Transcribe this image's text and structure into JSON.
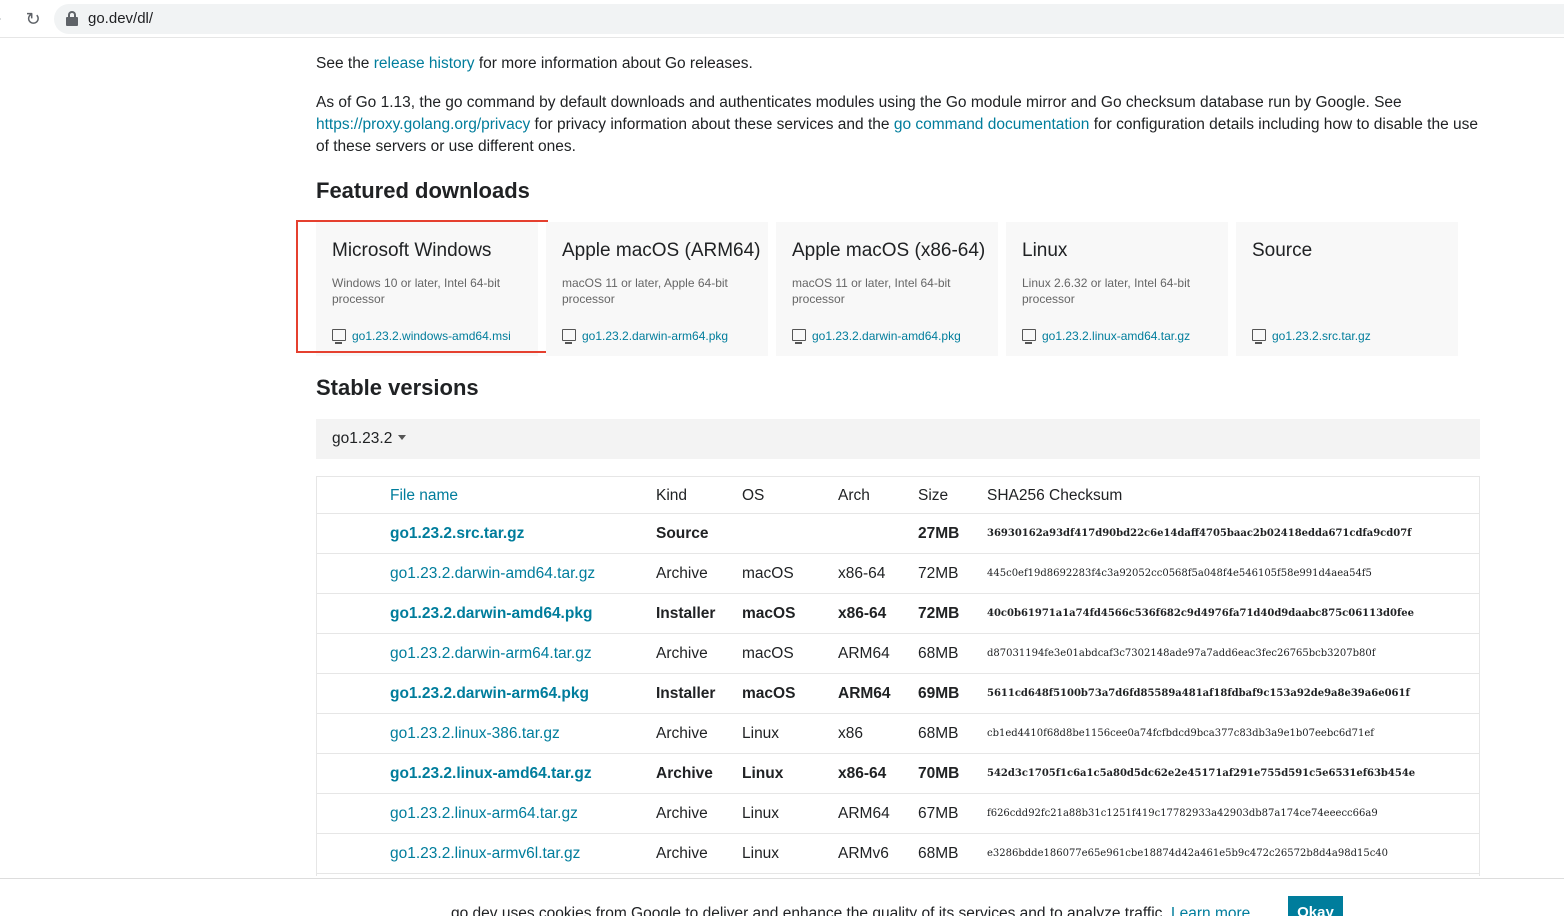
{
  "browser": {
    "url": "go.dev/dl/"
  },
  "intro": {
    "p1_before": "See the ",
    "p1_link": "release history",
    "p1_after": " for more information about Go releases.",
    "p2_part1": "As of Go 1.13, the go command by default downloads and authenticates modules using the Go module mirror and Go checksum database run by Google. See ",
    "p2_link1": "https://proxy.golang.org/privacy",
    "p2_part2": " for privacy information about these services and the ",
    "p2_link2": "go command documentation",
    "p2_part3": " for configuration details including how to disable the use of these servers or use different ones."
  },
  "featured": {
    "heading": "Featured downloads",
    "cards": [
      {
        "title": "Microsoft Windows",
        "desc": "Windows 10 or later, Intel 64-bit processor",
        "file": "go1.23.2.windows-amd64.msi",
        "highlighted": true
      },
      {
        "title": "Apple macOS (ARM64)",
        "desc": "macOS 11 or later, Apple 64-bit processor",
        "file": "go1.23.2.darwin-arm64.pkg"
      },
      {
        "title": "Apple macOS (x86-64)",
        "desc": "macOS 11 or later, Intel 64-bit processor",
        "file": "go1.23.2.darwin-amd64.pkg"
      },
      {
        "title": "Linux",
        "desc": "Linux 2.6.32 or later, Intel 64-bit processor",
        "file": "go1.23.2.linux-amd64.tar.gz"
      },
      {
        "title": "Source",
        "desc": "",
        "file": "go1.23.2.src.tar.gz"
      }
    ]
  },
  "stable": {
    "heading": "Stable versions",
    "selected_version": "go1.23.2",
    "columns": [
      "File name",
      "Kind",
      "OS",
      "Arch",
      "Size",
      "SHA256 Checksum"
    ],
    "rows": [
      {
        "file": "go1.23.2.src.tar.gz",
        "kind": "Source",
        "os": "",
        "arch": "",
        "size": "27MB",
        "sha": "36930162a93df417d90bd22c6e14daff4705baac2b02418edda671cdfa9cd07f",
        "bold": true
      },
      {
        "file": "go1.23.2.darwin-amd64.tar.gz",
        "kind": "Archive",
        "os": "macOS",
        "arch": "x86-64",
        "size": "72MB",
        "sha": "445c0ef19d8692283f4c3a92052cc0568f5a048f4e546105f58e991d4aea54f5",
        "bold": false
      },
      {
        "file": "go1.23.2.darwin-amd64.pkg",
        "kind": "Installer",
        "os": "macOS",
        "arch": "x86-64",
        "size": "72MB",
        "sha": "40c0b61971a1a74fd4566c536f682c9d4976fa71d40d9daabc875c06113d0fee",
        "bold": true
      },
      {
        "file": "go1.23.2.darwin-arm64.tar.gz",
        "kind": "Archive",
        "os": "macOS",
        "arch": "ARM64",
        "size": "68MB",
        "sha": "d87031194fe3e01abdcaf3c7302148ade97a7add6eac3fec26765bcb3207b80f",
        "bold": false
      },
      {
        "file": "go1.23.2.darwin-arm64.pkg",
        "kind": "Installer",
        "os": "macOS",
        "arch": "ARM64",
        "size": "69MB",
        "sha": "5611cd648f5100b73a7d6fd85589a481af18fdbaf9c153a92de9a8e39a6e061f",
        "bold": true
      },
      {
        "file": "go1.23.2.linux-386.tar.gz",
        "kind": "Archive",
        "os": "Linux",
        "arch": "x86",
        "size": "68MB",
        "sha": "cb1ed4410f68d8be1156cee0a74fcfbdcd9bca377c83db3a9e1b07eebc6d71ef",
        "bold": false
      },
      {
        "file": "go1.23.2.linux-amd64.tar.gz",
        "kind": "Archive",
        "os": "Linux",
        "arch": "x86-64",
        "size": "70MB",
        "sha": "542d3c1705f1c6a1c5a80d5dc62e2e45171af291e755d591c5e6531ef63b454e",
        "bold": true
      },
      {
        "file": "go1.23.2.linux-arm64.tar.gz",
        "kind": "Archive",
        "os": "Linux",
        "arch": "ARM64",
        "size": "67MB",
        "sha": "f626cdd92fc21a88b31c1251f419c17782933a42903db87a174ce74eeecc66a9",
        "bold": false
      },
      {
        "file": "go1.23.2.linux-armv6l.tar.gz",
        "kind": "Archive",
        "os": "Linux",
        "arch": "ARMv6",
        "size": "68MB",
        "sha": "e3286bdde186077e65e961cbe18874d42a461e5b9c472c26572b8d4a98d15c40",
        "bold": false
      }
    ]
  },
  "cookie": {
    "message": "go.dev uses cookies from Google to deliver and enhance the quality of its services and to analyze traffic.",
    "learn_more": "Learn more.",
    "okay": "Okay"
  },
  "colors": {
    "link": "#007d9c",
    "highlight_border": "#e5402f"
  }
}
